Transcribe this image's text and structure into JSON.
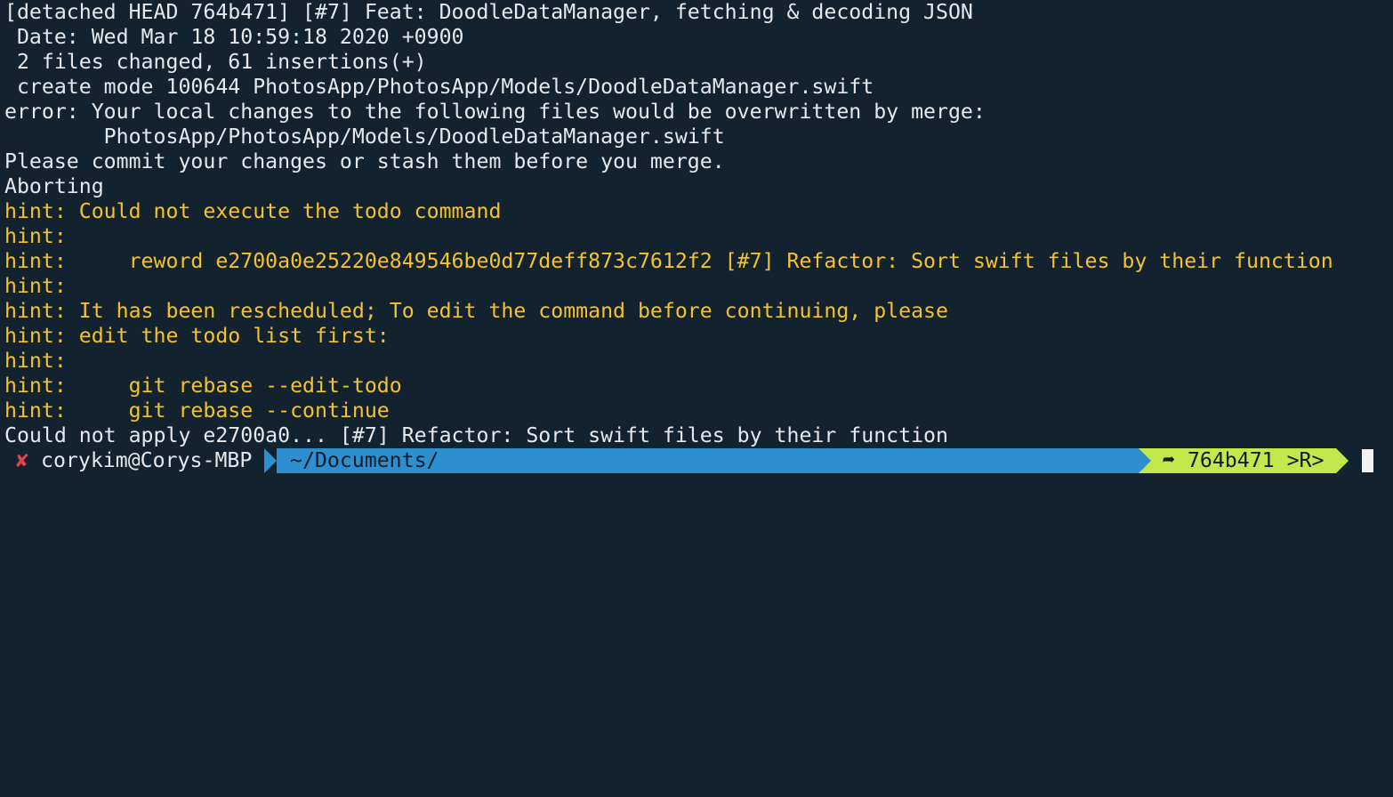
{
  "terminal": {
    "lines": [
      {
        "text": "[detached HEAD 764b471] [#7] Feat: DoodleDataManager, fetching & decoding JSON",
        "kind": "normal"
      },
      {
        "text": " Date: Wed Mar 18 10:59:18 2020 +0900",
        "kind": "normal"
      },
      {
        "text": " 2 files changed, 61 insertions(+)",
        "kind": "normal"
      },
      {
        "text": " create mode 100644 PhotosApp/PhotosApp/Models/DoodleDataManager.swift",
        "kind": "normal"
      },
      {
        "text": "error: Your local changes to the following files would be overwritten by merge:",
        "kind": "normal"
      },
      {
        "text": "        PhotosApp/PhotosApp/Models/DoodleDataManager.swift",
        "kind": "normal"
      },
      {
        "text": "Please commit your changes or stash them before you merge.",
        "kind": "normal"
      },
      {
        "text": "Aborting",
        "kind": "normal"
      },
      {
        "text": "hint: Could not execute the todo command",
        "kind": "hint"
      },
      {
        "text": "hint:",
        "kind": "hint"
      },
      {
        "text": "hint:     reword e2700a0e25220e849546be0d77deff873c7612f2 [#7] Refactor: Sort swift files by their function",
        "kind": "hint"
      },
      {
        "text": "hint:",
        "kind": "hint"
      },
      {
        "text": "hint: It has been rescheduled; To edit the command before continuing, please",
        "kind": "hint"
      },
      {
        "text": "hint: edit the todo list first:",
        "kind": "hint"
      },
      {
        "text": "hint:",
        "kind": "hint"
      },
      {
        "text": "hint:     git rebase --edit-todo",
        "kind": "hint"
      },
      {
        "text": "hint:     git rebase --continue",
        "kind": "hint"
      },
      {
        "text": "Could not apply e2700a0... [#7] Refactor: Sort swift files by their function",
        "kind": "normal"
      }
    ]
  },
  "prompt": {
    "status_icon": "✘",
    "user_host": "corykim@Corys-MBP",
    "path": "~/Documents/",
    "git": "➦ 764b471 >R>"
  },
  "colors": {
    "background": "#13222f",
    "text": "#e6e8ea",
    "hint": "#f5c22b",
    "error_icon": "#e0444c",
    "path_segment": "#2d8fcf",
    "git_segment": "#c2e84c"
  }
}
